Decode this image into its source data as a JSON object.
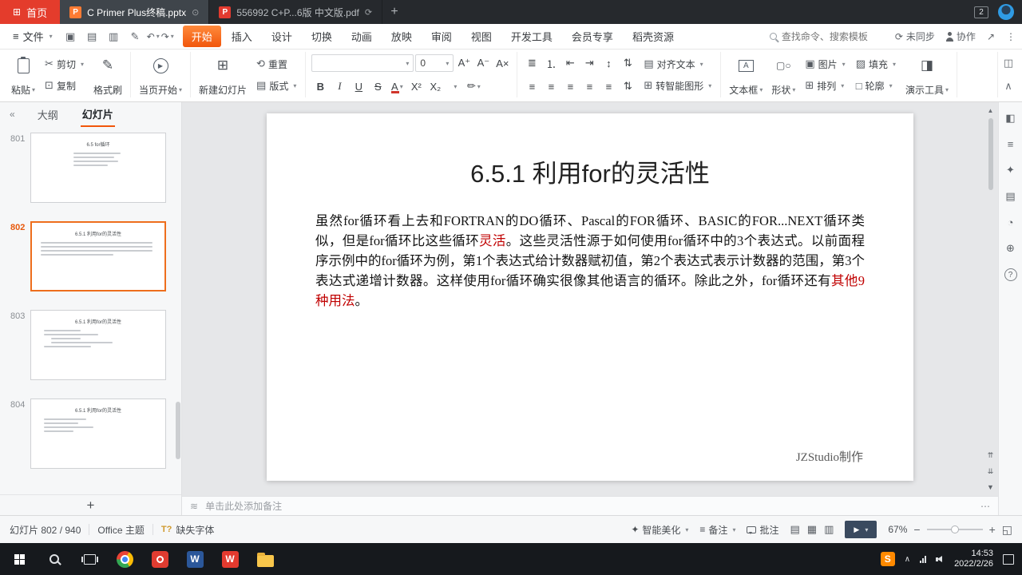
{
  "tab_bar": {
    "home_label": "首页",
    "tabs": [
      {
        "title": "C Primer  Plus终稿.pptx"
      },
      {
        "title": "556992 C+P...6版 中文版.pdf"
      }
    ],
    "window_badge": "2"
  },
  "menu": {
    "file_label": "文件",
    "tabs": [
      "开始",
      "插入",
      "设计",
      "切换",
      "动画",
      "放映",
      "审阅",
      "视图",
      "开发工具",
      "会员专享",
      "稻壳资源"
    ],
    "search_placeholder": "查找命令、搜索模板",
    "sync_label": "未同步",
    "collab_label": "协作"
  },
  "ribbon": {
    "paste": "粘贴",
    "cut": "剪切",
    "copy": "复制",
    "format_painter": "格式刷",
    "start_from_page": "当页开始",
    "new_slide": "新建幻灯片",
    "reset": "重置",
    "layout": "版式",
    "font_name": "",
    "font_size": "0",
    "bold": "B",
    "italic": "I",
    "underline": "U",
    "strike": "S",
    "font_color": "A",
    "superscript": "X²",
    "subscript": "X₂",
    "text_effect": "A",
    "align_text": "对齐文本",
    "to_smartart": "转智能图形",
    "textbox": "文本框",
    "shapes": "形状",
    "picture": "图片",
    "arrange": "排列",
    "fill": "填充",
    "outline": "轮廓",
    "present_tools": "演示工具"
  },
  "sidebar": {
    "outline_tab": "大纲",
    "slides_tab": "幻灯片",
    "slides": [
      {
        "number": "801",
        "title": "6.5 for循环"
      },
      {
        "number": "802",
        "title": "6.5.1 利用for的灵活性"
      },
      {
        "number": "803",
        "title": "6.5.1 利用for的灵活性"
      },
      {
        "number": "804",
        "title": "6.5.1 利用for的灵活性"
      }
    ]
  },
  "slide": {
    "title": "6.5.1 利用for的灵活性",
    "body": [
      {
        "text": "虽然for循环看上去和FORTRAN的DO循环、Pascal的FOR循环、BASIC的FOR...NEXT循环类似，但是for循环比这些循环",
        "red": false
      },
      {
        "text": "灵活",
        "red": true
      },
      {
        "text": "。这些灵活性源于如何使用for循环中的3个表达式。以前面程序示例中的for循环为例，第1个表达式给计数器赋初值，第2个表达式表示计数器的范围，第3个表达式递增计数器。这样使用for循环确实很像其他语言的循环。除此之外，for循环还有",
        "red": false
      },
      {
        "text": "其他9种用法",
        "red": true
      },
      {
        "text": "。",
        "red": false
      }
    ],
    "credit": "JZStudio制作"
  },
  "notes": {
    "placeholder": "单击此处添加备注"
  },
  "status_bar": {
    "slide_position": "幻灯片 802 / 940",
    "theme": "Office 主题",
    "missing_font": "缺失字体",
    "beautify": "智能美化",
    "notes_label": "备注",
    "comments_label": "批注",
    "zoom_percent": "67%"
  },
  "taskbar": {
    "time": "14:53",
    "date": "2022/2/26"
  },
  "icons": {
    "caret": "▾",
    "home_grid": "⊞",
    "eye": "⊙",
    "refresh": "⟳",
    "new_tab": "+",
    "hamburger": "≡",
    "save": "▣",
    "print": "▥",
    "export": "▤",
    "brush": "✎",
    "undo": "↶",
    "redo": "↷",
    "scissors": "✂",
    "copy_sq": "⊡",
    "painter": "✎",
    "play_tri": "▶",
    "reset_arrow": "⟲",
    "layout_sq": "▤",
    "slide_plus": "⊞",
    "grow_font": "A⁺",
    "shrink_font": "A⁻",
    "clear_format": "A×",
    "highlight": "✏",
    "bullets": "≣",
    "numbering": "⒈",
    "outdent": "⇤",
    "indent": "⇥",
    "direction": "↕",
    "linespacing": "⇅",
    "align_bars": "≡",
    "pic_sq": "▣",
    "fill_sq": "▨",
    "outline_sq": "□",
    "arrange_sq": "⊞",
    "textbox_a": "A",
    "shape_ic": "▢○",
    "present_ic": "◨",
    "share": "↗",
    "more_v": "⋮",
    "panel": "◫",
    "collapse": "∧",
    "side_collapse": "«",
    "scroll_up": "▲",
    "scroll_down": "▼",
    "prev_slides": "⇈",
    "next_slides": "⇊",
    "notes_lines": "≋",
    "ellipsis": "⋯",
    "beautify_star": "✦",
    "notes_ic": "≡",
    "view_normal": "▤",
    "view_sorter": "▦",
    "view_read": "▥",
    "minus": "−",
    "plus": "+",
    "fit": "◱",
    "missing_font_T": "T?",
    "ppt_letter": "P",
    "pdf_letter": "P",
    "word_w": "W",
    "wps_w": "W",
    "sogou_s": "S",
    "tool1": "◧",
    "tool2": "≡",
    "tool3": "✦",
    "tool4": "▤",
    "tool5": "◔",
    "tool6": "⊕",
    "help": "?"
  }
}
